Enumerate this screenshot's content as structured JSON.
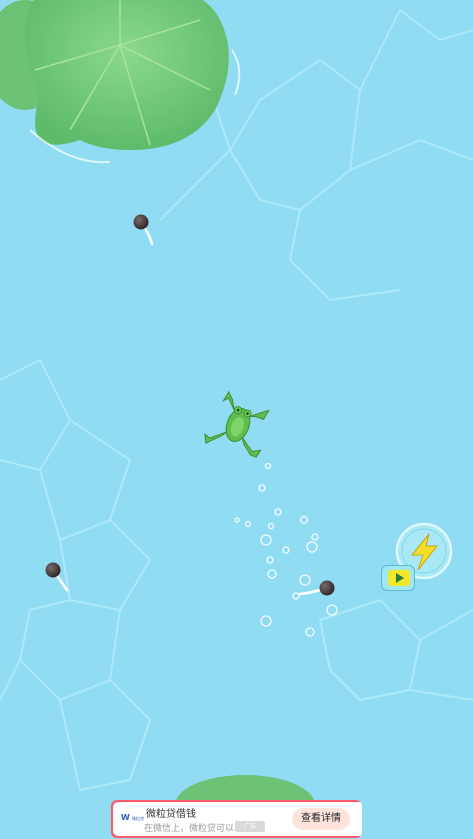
{
  "game": {
    "scene": "pond",
    "player": "frog",
    "enemies": "tadpoles",
    "colors": {
      "water": "#8fdcf3",
      "lily_pad": "#74c97a",
      "frog": "#5fbd4e",
      "tadpole": "#3a3030",
      "boost_icon": "#f3df2a"
    }
  },
  "hud": {
    "boost_icon": "lightning-icon",
    "video_icon": "play-video-icon"
  },
  "ad": {
    "logo": "W",
    "logo_sub": "微粒贷",
    "title": "微粒贷借钱",
    "description": "在微信上，微粒贷可以...",
    "tag": "广告",
    "cta": "查看详情",
    "close_icon": "×"
  }
}
